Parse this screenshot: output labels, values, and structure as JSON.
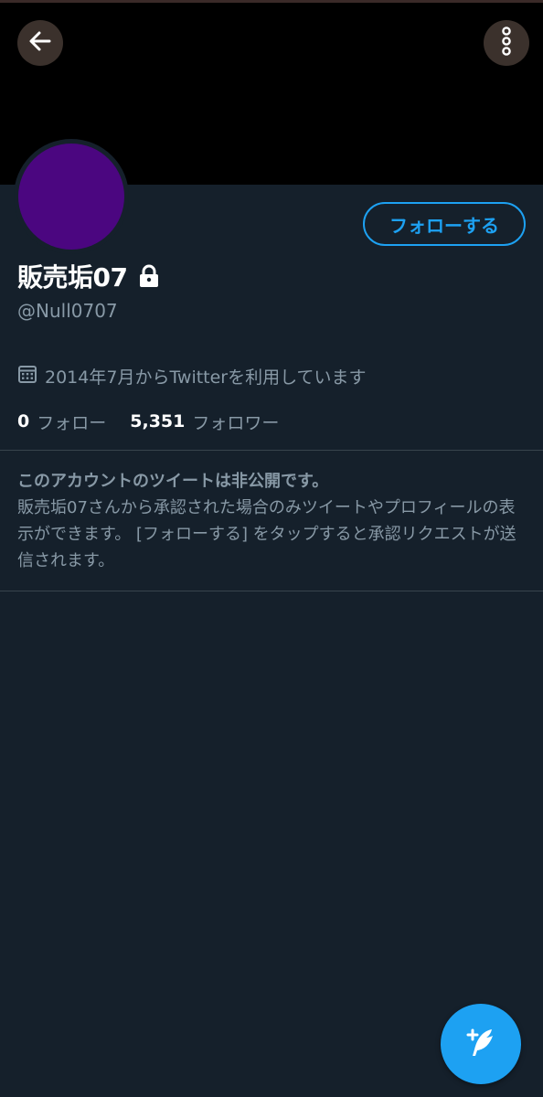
{
  "profile": {
    "display_name": "販売垢07",
    "handle": "@Null0707",
    "joined": "2014年7月からTwitterを利用しています",
    "following_count": "0",
    "following_label": "フォロー",
    "followers_count": "5,351",
    "followers_label": "フォロワー",
    "avatar_color": "#4b0680",
    "banner_color": "#000000"
  },
  "actions": {
    "follow_label": "フォローする",
    "back_icon": "arrow-left-icon",
    "more_icon": "more-vertical-icon",
    "compose_icon": "compose-feather-icon"
  },
  "protected_notice": {
    "title": "このアカウントのツイートは非公開です。",
    "body": "販売垢07さんから承認された場合のみツイートやプロフィールの表示ができます。 [フォローする] をタップすると承認リクエストが送信されます。"
  },
  "colors": {
    "accent": "#1da1f2",
    "background": "#15202b",
    "secondary_text": "#8899a6",
    "divider": "#38444d"
  }
}
